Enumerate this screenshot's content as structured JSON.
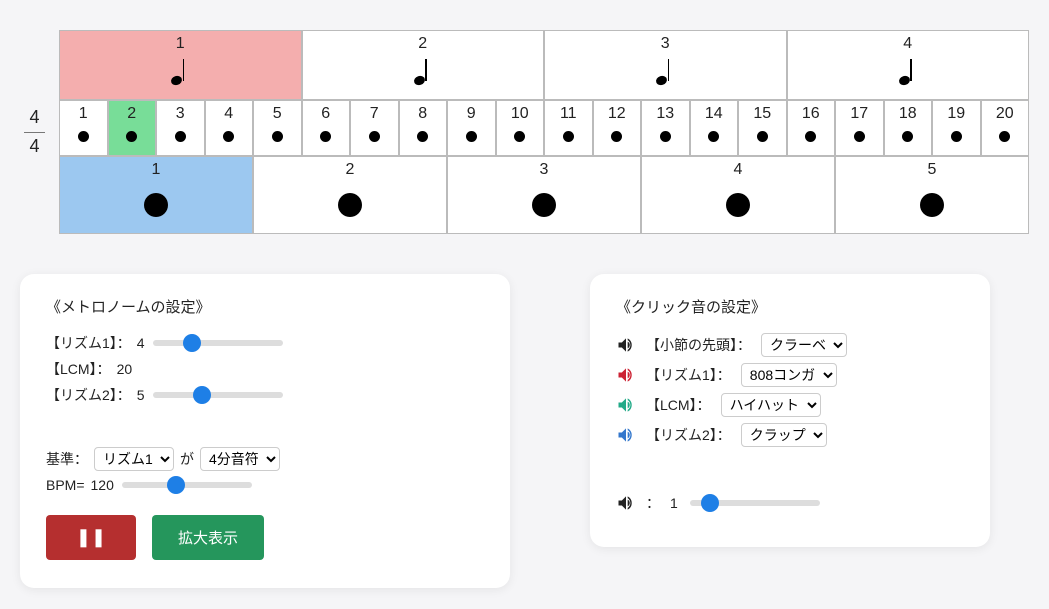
{
  "timeSig": {
    "top": "4",
    "bottom": "4"
  },
  "row1": {
    "count": 4,
    "highlightIndex": 0,
    "labels": [
      "1",
      "2",
      "3",
      "4"
    ]
  },
  "row2": {
    "count": 20,
    "highlightIndex": 1,
    "labels": [
      "1",
      "2",
      "3",
      "4",
      "5",
      "6",
      "7",
      "8",
      "9",
      "10",
      "11",
      "12",
      "13",
      "14",
      "15",
      "16",
      "17",
      "18",
      "19",
      "20"
    ]
  },
  "row3": {
    "count": 5,
    "highlightIndex": 0,
    "labels": [
      "1",
      "2",
      "3",
      "4",
      "5"
    ]
  },
  "metPanel": {
    "title": "《メトロノームの設定》",
    "rhythm1Label": "【リズム1】：",
    "rhythm1Value": "4",
    "lcmLabel": "【LCM】：",
    "lcmValue": "20",
    "rhythm2Label": "【リズム2】：",
    "rhythm2Value": "5",
    "baseLabel": "基準：",
    "baseSelect": "リズム1",
    "gaLabel": "が",
    "noteSelect": "4分音符",
    "bpmLabel": "BPM=",
    "bpmValue": "120",
    "expandLabel": "拡大表示"
  },
  "sndPanel": {
    "title": "《クリック音の設定》",
    "rows": [
      {
        "color": "#222",
        "label": "【小節の先頭】：",
        "value": "クラーベ"
      },
      {
        "color": "#c23",
        "label": "【リズム1】：",
        "value": "808コンガ"
      },
      {
        "color": "#2a8",
        "label": "【LCM】：",
        "value": "ハイハット"
      },
      {
        "color": "#37c",
        "label": "【リズム2】：",
        "value": "クラップ"
      }
    ],
    "volPrefix": "：",
    "volValue": "1"
  }
}
